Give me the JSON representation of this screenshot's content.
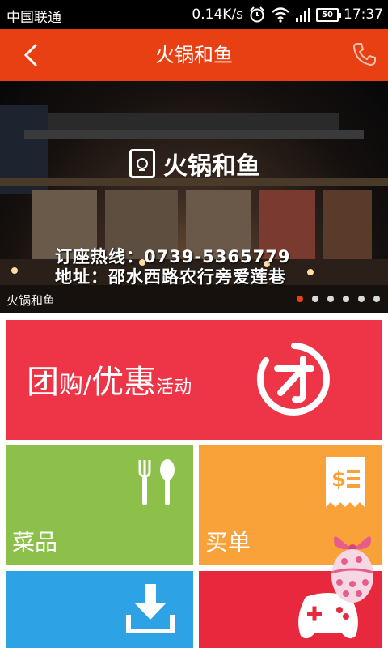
{
  "status_bar": {
    "carrier": "中国联通",
    "network_speed": "0.14K/s",
    "battery": "50",
    "time": "17:37",
    "icons": [
      "alarm-icon",
      "wifi-icon",
      "signal-icon",
      "battery-icon"
    ]
  },
  "header": {
    "title": "火锅和鱼",
    "back_icon": "chevron-left-icon",
    "phone_icon": "phone-icon",
    "color": "#e84013"
  },
  "banner": {
    "sign_text": "火锅和鱼",
    "overlay_line1": "订座热线：0739-5365779",
    "overlay_line2": "地址：邵水西路农行旁爱莲巷",
    "caption": "火锅和鱼",
    "slide_count": 6,
    "active_slide": 1
  },
  "tiles": {
    "groupbuy": {
      "part1": "团",
      "part2": "购",
      "part3": "/",
      "part4": "优惠",
      "part5": "活动",
      "icon": "tuan-circle-icon",
      "color": "#ee3548"
    },
    "dishes": {
      "label": "菜品",
      "icon": "fork-spoon-icon",
      "color": "#8dc04b"
    },
    "bill": {
      "label": "买单",
      "icon": "receipt-icon",
      "color": "#f9a23a"
    },
    "download": {
      "icon": "download-icon",
      "color": "#2da3e6"
    },
    "game": {
      "icon": "gamepad-icon",
      "color": "#e8283c"
    }
  },
  "floating": {
    "icon": "easter-egg-icon"
  }
}
